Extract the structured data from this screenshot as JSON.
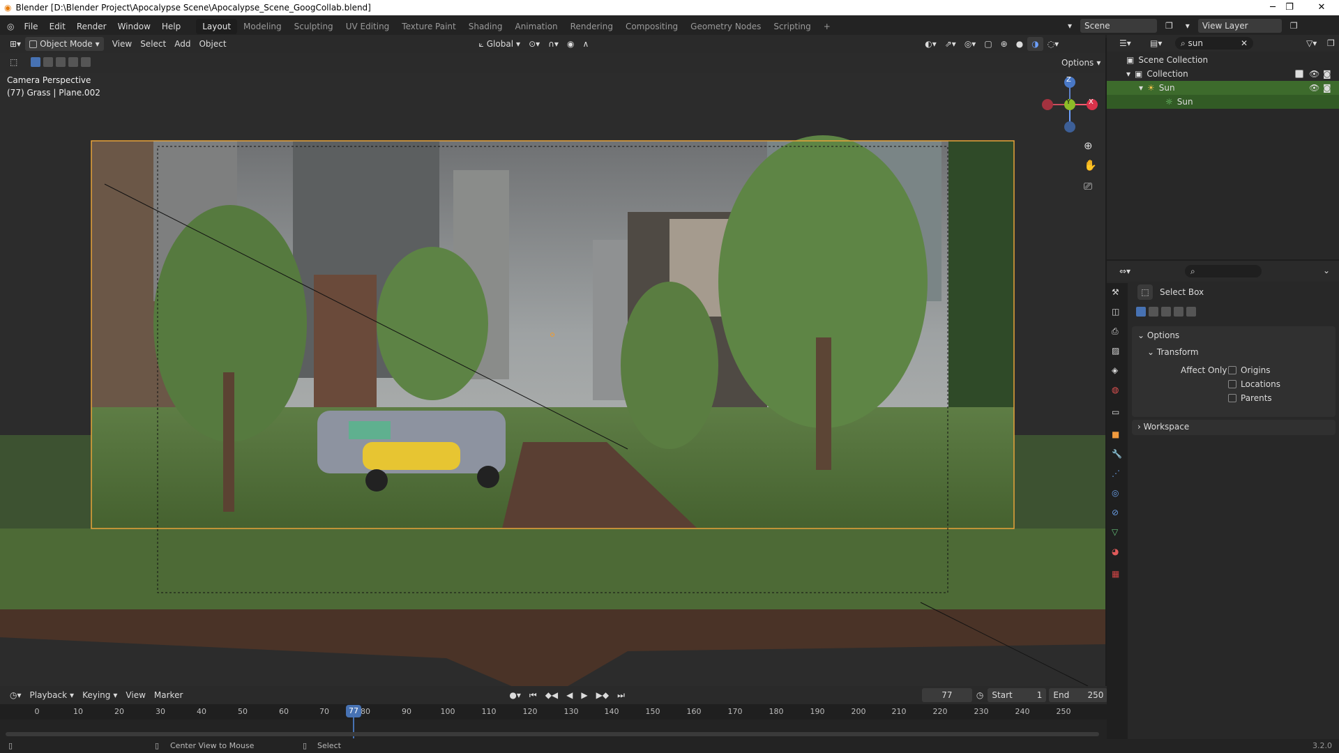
{
  "titlebar": {
    "title": "Blender [D:\\Blender Project\\Apocalypse Scene\\Apocalypse_Scene_GoogCollab.blend]",
    "minimize": "─",
    "maximize": "❐",
    "close": "✕"
  },
  "menu": [
    "File",
    "Edit",
    "Render",
    "Window",
    "Help"
  ],
  "workspaces": [
    "Layout",
    "Modeling",
    "Sculpting",
    "UV Editing",
    "Texture Paint",
    "Shading",
    "Animation",
    "Rendering",
    "Compositing",
    "Geometry Nodes",
    "Scripting"
  ],
  "active_workspace": "Layout",
  "add_workspace": "+",
  "scene_name": "Scene",
  "view_layer": "View Layer",
  "viewport_header": {
    "mode": "Object Mode",
    "menus": [
      "View",
      "Select",
      "Add",
      "Object"
    ],
    "orientation": "Global",
    "options": "Options"
  },
  "viewport": {
    "overlay_title": "Camera Perspective",
    "overlay_sub": "(77) Grass | Plane.002",
    "gizmo": {
      "z": "Z",
      "y": "Y",
      "x": "X"
    }
  },
  "timeline": {
    "menus": [
      "Playback",
      "Keying",
      "View",
      "Marker"
    ],
    "current_frame": "77",
    "start_label": "Start",
    "start": "1",
    "end_label": "End",
    "end": "250",
    "ruler": [
      "0",
      "10",
      "20",
      "30",
      "40",
      "50",
      "60",
      "70",
      "80",
      "90",
      "100",
      "110",
      "120",
      "130",
      "140",
      "150",
      "160",
      "170",
      "180",
      "190",
      "200",
      "210",
      "220",
      "230",
      "240",
      "250"
    ],
    "playhead": "77"
  },
  "status": {
    "left_hint": "Center View to Mouse",
    "mid_hint": "Select",
    "version": "3.2.0"
  },
  "outliner": {
    "search": "sun",
    "rows": [
      {
        "label": "Scene Collection"
      },
      {
        "label": "Collection"
      },
      {
        "label": "Sun"
      },
      {
        "label": "Sun"
      }
    ]
  },
  "properties": {
    "tool_name": "Select Box",
    "sections": {
      "options": "Options",
      "transform": "Transform",
      "affect_only": "Affect Only",
      "origins": "Origins",
      "locations": "Locations",
      "parents": "Parents",
      "workspace": "Workspace"
    }
  },
  "colors": {
    "accent": "#4772b3",
    "selection_green": "#3d6b2c",
    "camera_frame": "#e8a33a",
    "playhead": "#4772b3"
  }
}
